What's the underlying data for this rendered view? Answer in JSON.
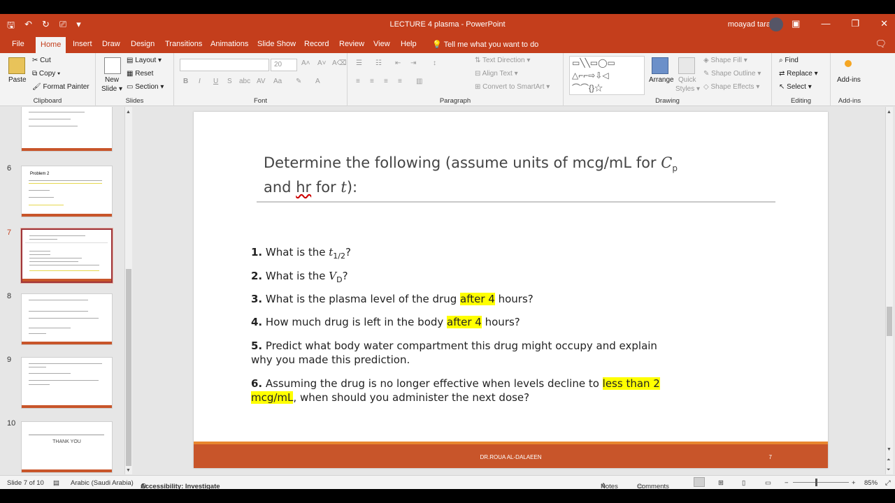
{
  "app": {
    "title": "LECTURE 4 plasma  -  PowerPoint",
    "user": "moayad tara",
    "accent": "#c43e1c"
  },
  "tabs": [
    "File",
    "Home",
    "Insert",
    "Draw",
    "Design",
    "Transitions",
    "Animations",
    "Slide Show",
    "Record",
    "Review",
    "View",
    "Help"
  ],
  "active_tab": "Home",
  "tell_me": "Tell me what you want to do",
  "ribbon": {
    "clipboard": {
      "paste": "Paste",
      "cut": "Cut",
      "copy": "Copy",
      "format_painter": "Format Painter",
      "label": "Clipboard"
    },
    "slides": {
      "new_slide_1": "New",
      "new_slide_2": "Slide",
      "layout": "Layout",
      "reset": "Reset",
      "section": "Section",
      "label": "Slides"
    },
    "font": {
      "size": "20",
      "label": "Font"
    },
    "paragraph": {
      "text_direction": "Text Direction",
      "align_text": "Align Text",
      "convert": "Convert to SmartArt",
      "label": "Paragraph"
    },
    "drawing": {
      "arrange": "Arrange",
      "quick_styles_1": "Quick",
      "quick_styles_2": "Styles",
      "shape_fill": "Shape Fill",
      "shape_outline": "Shape Outline",
      "shape_effects": "Shape Effects",
      "label": "Drawing"
    },
    "editing": {
      "find": "Find",
      "replace": "Replace",
      "select": "Select",
      "label": "Editing"
    },
    "addins": {
      "btn": "Add-ins",
      "label": "Add-ins"
    }
  },
  "thumbnails": [
    {
      "num": "",
      "title": ""
    },
    {
      "num": "6",
      "title": "Problem 2"
    },
    {
      "num": "7",
      "title": "Determine the following"
    },
    {
      "num": "8",
      "title": ""
    },
    {
      "num": "9",
      "title": ""
    },
    {
      "num": "10",
      "title": "THANK YOU"
    }
  ],
  "slide": {
    "title_line1": "Determine the following (assume units of mcg/mL for ",
    "title_cp": "C",
    "title_cp_sub": "p",
    "title_line2a": "and ",
    "title_hr": "hr",
    "title_line2b": " for ",
    "title_t": "t",
    "title_line2c": "):",
    "q1": {
      "num": "1.",
      "text": " What is the ",
      "sym": "t",
      "sub": "1/2",
      "end": "?"
    },
    "q2": {
      "num": "2.",
      "text": " What is the ",
      "sym": "V",
      "sub": "D",
      "end": "?"
    },
    "q3": {
      "num": "3.",
      "text": " What is the plasma level of the drug ",
      "hl": "after 4",
      "end": " hours?"
    },
    "q4": {
      "num": "4.",
      "text": " How much drug is left in the body ",
      "hl": "after 4",
      "end": " hours?"
    },
    "q5": {
      "num": "5.",
      "text": " Predict what body water compartment this drug might occupy and explain why you made this prediction."
    },
    "q6": {
      "num": "6.",
      "text": " Assuming the drug is no longer effective when levels decline to ",
      "hl": "less than 2 mcg/mL",
      "end": ", when should you administer the next dose?"
    },
    "footer": "DR.ROUA AL-DALAEEN",
    "page": "7"
  },
  "status": {
    "slide_of": "Slide 7 of 10",
    "language": "Arabic (Saudi Arabia)",
    "accessibility": "Accessibility: Investigate",
    "notes": "Notes",
    "comments": "Comments",
    "zoom": "85%"
  }
}
